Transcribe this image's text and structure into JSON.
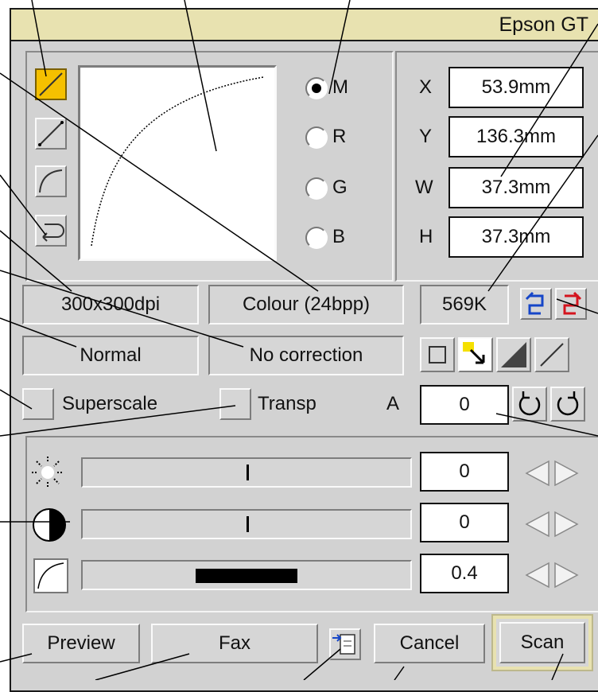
{
  "window": {
    "title": "Epson GT"
  },
  "curve_modes": [
    "M",
    "R",
    "G",
    "B"
  ],
  "selected_mode": "M",
  "coords": [
    {
      "label": "X",
      "value": "53.9mm"
    },
    {
      "label": "Y",
      "value": "136.3mm"
    },
    {
      "label": "W",
      "value": "37.3mm"
    },
    {
      "label": "H",
      "value": "37.3mm"
    }
  ],
  "resolution": "300x300dpi",
  "colour_mode": "Colour (24bpp)",
  "file_size": "569K",
  "render": "Normal",
  "correction": "No correction",
  "superscale_label": "Superscale",
  "transp_label": "Transp",
  "angle_label": "A",
  "angle_value": "0",
  "adjust": {
    "brightness_value": "0",
    "contrast_value": "0",
    "gamma_value": "0.4",
    "brightness_level": 0.5,
    "contrast_level": 0.5,
    "gamma_level": 0.4
  },
  "buttons": {
    "preview": "Preview",
    "fax": "Fax",
    "cancel": "Cancel",
    "scan": "Scan"
  },
  "colors": {
    "title_bg": "#e8e2b0",
    "highlight": "#f5c000",
    "window_bg": "#d2d2d2"
  }
}
